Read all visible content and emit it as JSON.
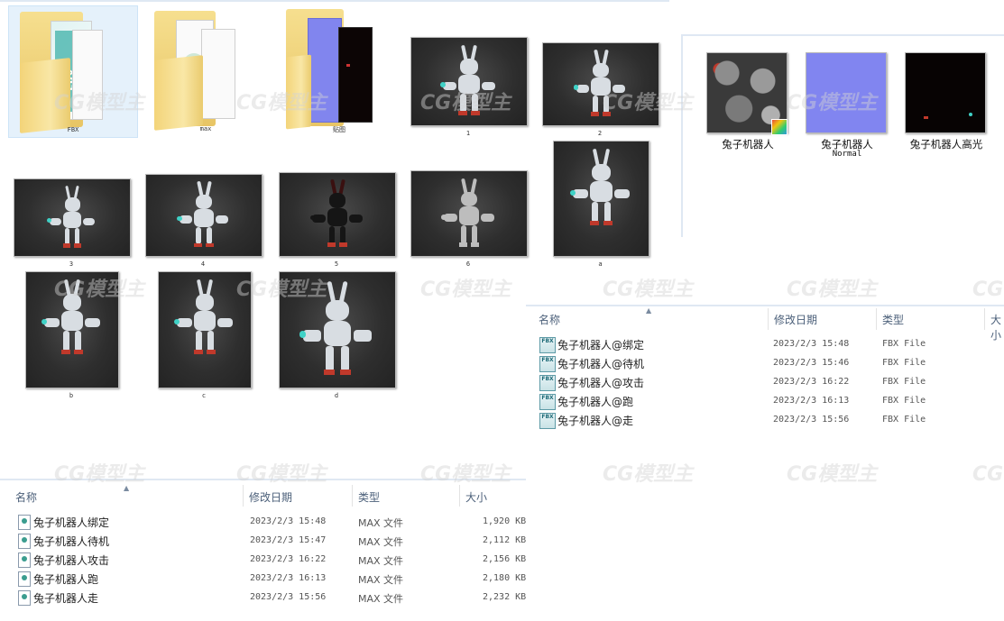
{
  "folders": [
    {
      "caption": "FBX",
      "name": "fbx-folder"
    },
    {
      "caption": "max",
      "name": "max-folder"
    },
    {
      "caption": "贴图",
      "name": "texture-folder"
    }
  ],
  "renders": [
    "1",
    "2",
    "3",
    "4",
    "5",
    "6",
    "a",
    "b",
    "c",
    "d"
  ],
  "textures": {
    "items": [
      {
        "label": "兔子机器人",
        "sub": ""
      },
      {
        "label": "兔子机器人",
        "sub": "Normal"
      },
      {
        "label": "兔子机器人高光",
        "sub": ""
      }
    ]
  },
  "fbx_list": {
    "headers": {
      "name": "名称",
      "date": "修改日期",
      "type": "类型",
      "size": "大小"
    },
    "icon_label": "FBX",
    "rows": [
      {
        "name": "兔子机器人@绑定",
        "date": "2023/2/3 15:48",
        "type": "FBX File"
      },
      {
        "name": "兔子机器人@待机",
        "date": "2023/2/3 15:46",
        "type": "FBX File"
      },
      {
        "name": "兔子机器人@攻击",
        "date": "2023/2/3 16:22",
        "type": "FBX File"
      },
      {
        "name": "兔子机器人@跑",
        "date": "2023/2/3 16:13",
        "type": "FBX File"
      },
      {
        "name": "兔子机器人@走",
        "date": "2023/2/3 15:56",
        "type": "FBX File"
      }
    ]
  },
  "max_list": {
    "headers": {
      "name": "名称",
      "date": "修改日期",
      "type": "类型",
      "size": "大小"
    },
    "rows": [
      {
        "name": "兔子机器人绑定",
        "date": "2023/2/3 15:48",
        "type": "MAX 文件",
        "size": "1,920 KB"
      },
      {
        "name": "兔子机器人待机",
        "date": "2023/2/3 15:47",
        "type": "MAX 文件",
        "size": "2,112 KB"
      },
      {
        "name": "兔子机器人攻击",
        "date": "2023/2/3 16:22",
        "type": "MAX 文件",
        "size": "2,156 KB"
      },
      {
        "name": "兔子机器人跑",
        "date": "2023/2/3 16:13",
        "type": "MAX 文件",
        "size": "2,180 KB"
      },
      {
        "name": "兔子机器人走",
        "date": "2023/2/3 15:56",
        "type": "MAX 文件",
        "size": "2,232 KB"
      }
    ]
  },
  "watermark_text": "CG模型主",
  "colors": {
    "robot_white": "#d8dde2",
    "robot_accent": "#c0392b",
    "robot_glow": "#3fd1c6"
  }
}
